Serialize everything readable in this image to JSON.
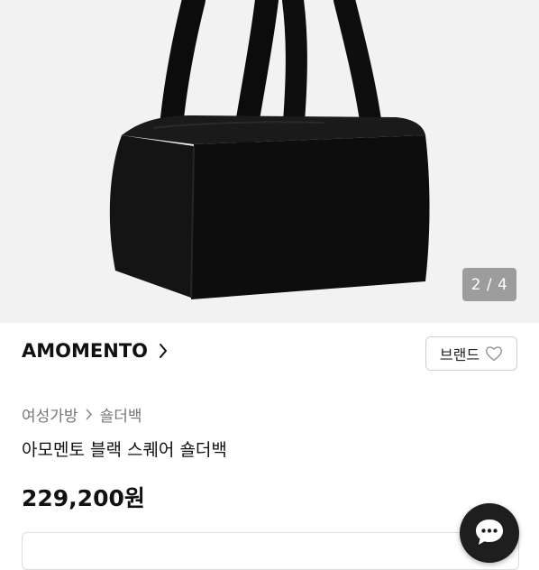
{
  "gallery": {
    "current": 2,
    "total": 4,
    "counter_text": "2 / 4",
    "image_icon": "black-shoulder-bag-image",
    "background": "#f2f2f2"
  },
  "brand": {
    "name": "AMOMENTO",
    "button_label": "브랜드",
    "button_icon": "heart-outline-icon",
    "chevron_icon": "chevron-right-icon"
  },
  "breadcrumb": {
    "items": [
      "여성가방",
      "숄더백"
    ],
    "separator_icon": "chevron-right-icon"
  },
  "product": {
    "title": "아모멘토 블랙 스퀘어 숄더백",
    "price": "229,200원"
  },
  "chat": {
    "icon": "chat-bubble-icon",
    "color": "#1e1e1e"
  }
}
